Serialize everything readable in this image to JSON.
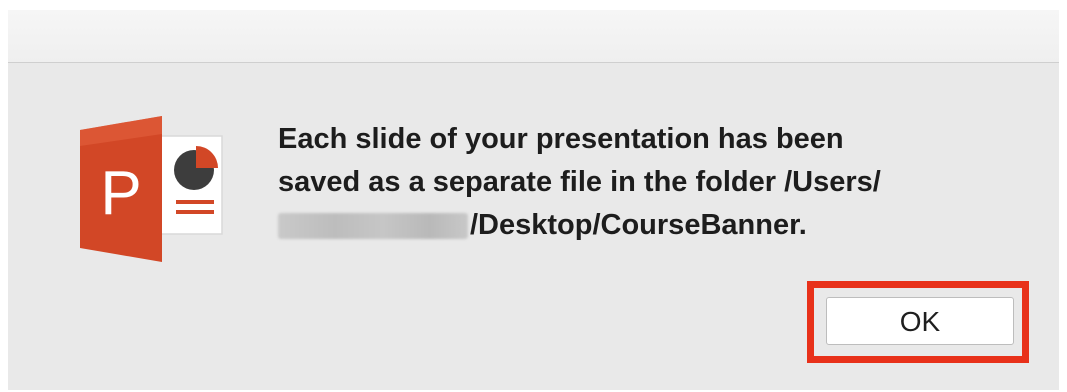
{
  "dialog": {
    "icon": "powerpoint-app-icon",
    "icon_letter": "P",
    "message_line1": "Each slide of your presentation has been",
    "message_line2": "saved as a separate file in the folder /Users/",
    "message_line3": "/Desktop/CourseBanner.",
    "redacted_segment": "blurred-username",
    "ok_label": "OK"
  },
  "colors": {
    "highlight": "#e8311a",
    "powerpoint_orange": "#d24726",
    "dialog_background": "#e9e9e9"
  }
}
